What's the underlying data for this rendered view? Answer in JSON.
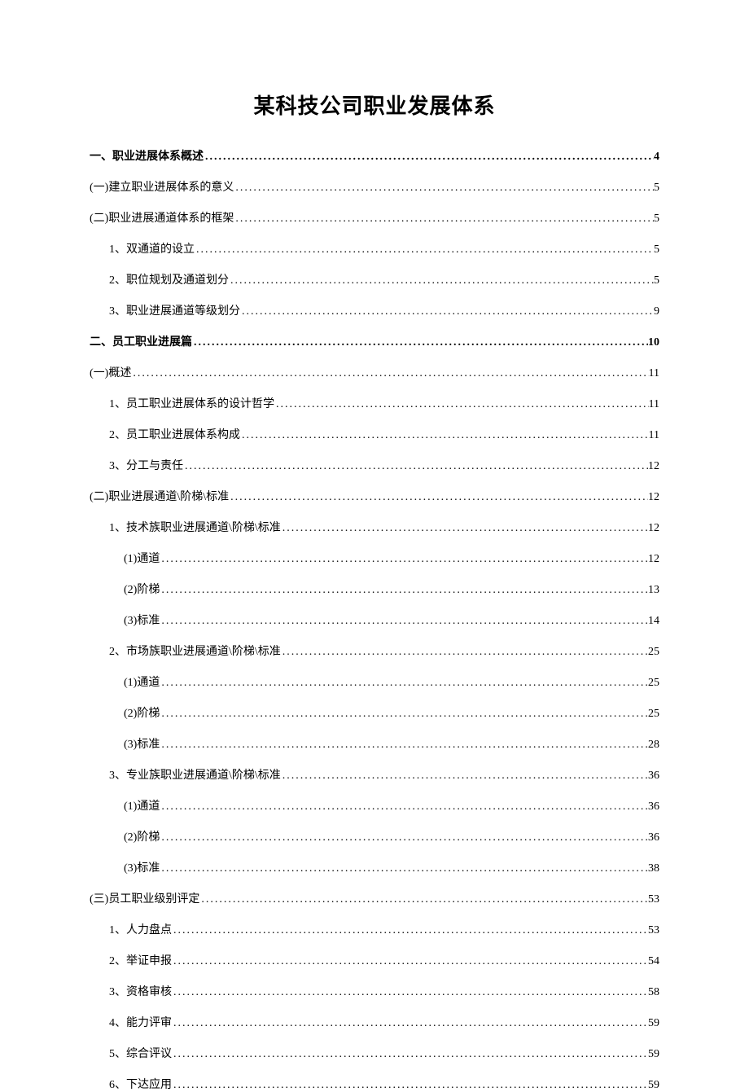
{
  "title": "某科技公司职业发展体系",
  "toc": [
    {
      "label": "一、职业进展体系概述",
      "page": "4",
      "level": 0
    },
    {
      "label": "(一)建立职业进展体系的意义",
      "page": "5",
      "level": 1
    },
    {
      "label": "(二)职业进展通道体系的框架",
      "page": "5",
      "level": 1
    },
    {
      "label": "1、双通道的设立",
      "page": "5",
      "level": 2
    },
    {
      "label": "2、职位规划及通道划分",
      "page": "5",
      "level": 2
    },
    {
      "label": "3、职业进展通道等级划分",
      "page": "9",
      "level": 2
    },
    {
      "label": "二、员工职业进展篇",
      "page": "10",
      "level": 0
    },
    {
      "label": "(一)概述",
      "page": "11",
      "level": 1
    },
    {
      "label": "1、员工职业进展体系的设计哲学",
      "page": "11",
      "level": 2
    },
    {
      "label": "2、员工职业进展体系构成",
      "page": "11",
      "level": 2
    },
    {
      "label": "3、分工与责任",
      "page": "12",
      "level": 2
    },
    {
      "label": "(二)职业进展通道\\阶梯\\标准",
      "page": "12",
      "level": 1
    },
    {
      "label": "1、技术族职业进展通道\\阶梯\\标准",
      "page": "12",
      "level": 2
    },
    {
      "label": "(1)通道",
      "page": "12",
      "level": 3
    },
    {
      "label": "(2)阶梯",
      "page": "13",
      "level": 3
    },
    {
      "label": "(3)标准",
      "page": "14",
      "level": 3
    },
    {
      "label": "2、市场族职业进展通道\\阶梯\\标准",
      "page": "25",
      "level": 2
    },
    {
      "label": "(1)通道",
      "page": "25",
      "level": 3
    },
    {
      "label": "(2)阶梯",
      "page": "25",
      "level": 3
    },
    {
      "label": "(3)标准",
      "page": "28",
      "level": 3
    },
    {
      "label": "3、专业族职业进展通道\\阶梯\\标准",
      "page": "36",
      "level": 2
    },
    {
      "label": "(1)通道",
      "page": "36",
      "level": 3
    },
    {
      "label": "(2)阶梯",
      "page": "36",
      "level": 3
    },
    {
      "label": "(3)标准",
      "page": "38",
      "level": 3
    },
    {
      "label": "(三)员工职业级别评定",
      "page": "53",
      "level": 1
    },
    {
      "label": "1、人力盘点",
      "page": "53",
      "level": 2
    },
    {
      "label": "2、举证申报",
      "page": "54",
      "level": 2
    },
    {
      "label": "3、资格审核",
      "page": "58",
      "level": 2
    },
    {
      "label": "4、能力评审",
      "page": "59",
      "level": 2
    },
    {
      "label": "5、综合评议",
      "page": "59",
      "level": 2
    },
    {
      "label": "6、下达应用",
      "page": "59",
      "level": 2
    }
  ]
}
